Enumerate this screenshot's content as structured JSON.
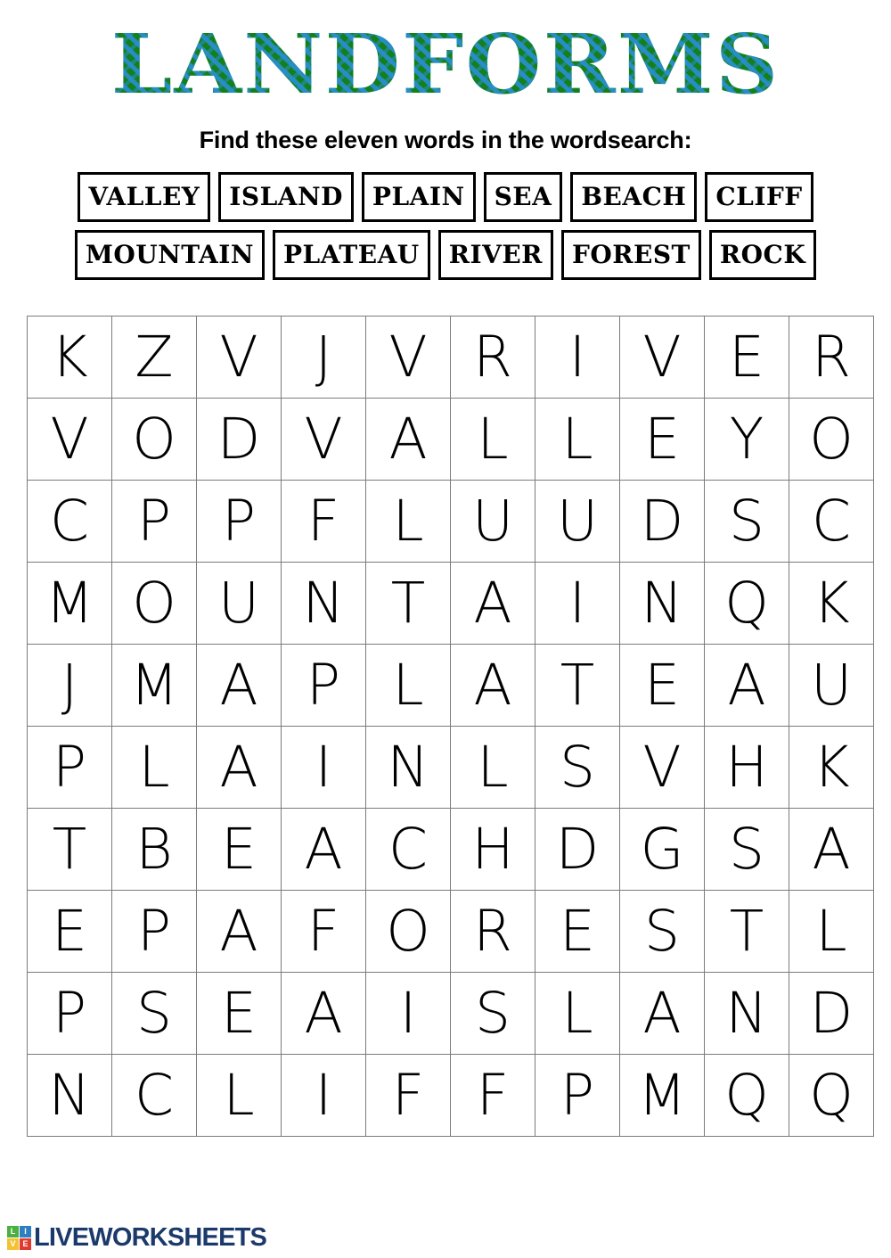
{
  "title": "LANDFORMS",
  "title_colors": {
    "base_green": "#13801b",
    "stripe_blue": "#298ed1"
  },
  "subtitle": "Find these eleven words in the wordsearch:",
  "wordlist": {
    "rows": [
      [
        "VALLEY",
        "ISLAND",
        "PLAIN",
        "SEA",
        "BEACH",
        "CLIFF"
      ],
      [
        "MOUNTAIN",
        "PLATEAU",
        "RIVER",
        "FOREST",
        "ROCK"
      ]
    ]
  },
  "grid": {
    "rows": 10,
    "cols": 10,
    "letters": [
      [
        "K",
        "Z",
        "V",
        "J",
        "V",
        "R",
        "I",
        "V",
        "E",
        "R"
      ],
      [
        "V",
        "O",
        "D",
        "V",
        "A",
        "L",
        "L",
        "E",
        "Y",
        "O"
      ],
      [
        "C",
        "P",
        "P",
        "F",
        "L",
        "U",
        "U",
        "D",
        "S",
        "C"
      ],
      [
        "M",
        "O",
        "U",
        "N",
        "T",
        "A",
        "I",
        "N",
        "Q",
        "K"
      ],
      [
        "J",
        "M",
        "A",
        "P",
        "L",
        "A",
        "T",
        "E",
        "A",
        "U"
      ],
      [
        "P",
        "L",
        "A",
        "I",
        "N",
        "L",
        "S",
        "V",
        "H",
        "K"
      ],
      [
        "T",
        "B",
        "E",
        "A",
        "C",
        "H",
        "D",
        "G",
        "S",
        "A"
      ],
      [
        "E",
        "P",
        "A",
        "F",
        "O",
        "R",
        "E",
        "S",
        "T",
        "L"
      ],
      [
        "P",
        "S",
        "E",
        "A",
        "I",
        "S",
        "L",
        "A",
        "N",
        "D"
      ],
      [
        "N",
        "C",
        "L",
        "I",
        "F",
        "F",
        "P",
        "M",
        "Q",
        "Q"
      ]
    ]
  },
  "footer": {
    "logo_text": "LIVEWORKSHEETS",
    "logo_tiles": [
      {
        "letter": "L",
        "color": "#4caf3f"
      },
      {
        "letter": "I",
        "color": "#2d7fc1"
      },
      {
        "letter": "V",
        "color": "#f2c230"
      },
      {
        "letter": "E",
        "color": "#e03b2f"
      }
    ]
  }
}
